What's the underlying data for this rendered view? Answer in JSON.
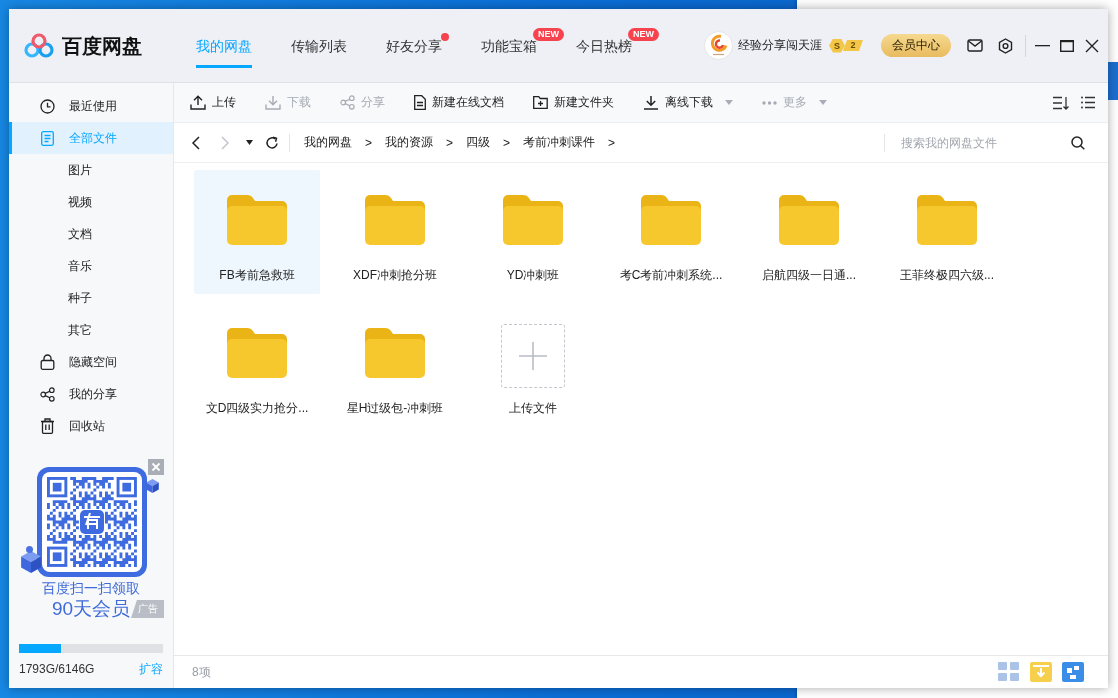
{
  "window": {
    "app_name": "百度网盘",
    "tabs": [
      {
        "label": "我的网盘",
        "selected": true,
        "dot": false
      },
      {
        "label": "传输列表",
        "selected": false,
        "dot": false
      },
      {
        "label": "好友分享",
        "selected": false,
        "dot": true
      },
      {
        "label": "功能宝箱",
        "selected": false,
        "dot": false,
        "badge": "NEW"
      },
      {
        "label": "今日热榜",
        "selected": false,
        "dot": false,
        "badge": "NEW"
      }
    ]
  },
  "user": {
    "name": "经验分享闯天涯",
    "level_badge": {
      "letter": "S",
      "level": "2"
    },
    "vip_button": "会员中心"
  },
  "toolbar": {
    "items": [
      {
        "kind": "upload",
        "label": "上传",
        "disabled": false,
        "dropdown": false
      },
      {
        "kind": "download",
        "label": "下载",
        "disabled": true,
        "dropdown": false
      },
      {
        "kind": "share",
        "label": "分享",
        "disabled": true,
        "dropdown": false
      },
      {
        "kind": "document",
        "label": "新建在线文档",
        "disabled": false,
        "dropdown": false
      },
      {
        "kind": "folder",
        "label": "新建文件夹",
        "disabled": false,
        "dropdown": false
      },
      {
        "kind": "offline",
        "label": "离线下载",
        "disabled": false,
        "dropdown": true
      },
      {
        "kind": "more",
        "label": "更多",
        "disabled": true,
        "dropdown": true
      }
    ]
  },
  "navigation": {
    "back_disabled": false,
    "forward_disabled": true,
    "breadcrumb": [
      "我的网盘",
      "我的资源",
      "四级",
      "考前冲刺课件"
    ],
    "separator": ">",
    "search": {
      "placeholder": "搜索我的网盘文件"
    }
  },
  "sidebar": {
    "items": [
      {
        "kind": "recent",
        "label": "最近使用",
        "selected": false
      },
      {
        "kind": "files",
        "label": "全部文件",
        "selected": true,
        "children": [
          {
            "label": "图片",
            "selected": false
          },
          {
            "label": "视频",
            "selected": false
          },
          {
            "label": "文档",
            "selected": false
          },
          {
            "label": "音乐",
            "selected": false
          },
          {
            "label": "种子",
            "selected": false
          },
          {
            "label": "其它",
            "selected": false
          }
        ]
      },
      {
        "kind": "hidden",
        "label": "隐藏空间",
        "selected": false
      },
      {
        "kind": "share",
        "label": "我的分享",
        "selected": false
      },
      {
        "kind": "trash",
        "label": "回收站",
        "selected": false
      }
    ],
    "ad": {
      "line1": "百度扫一扫领取",
      "line2": "90天会员",
      "tag": "广告"
    },
    "storage": {
      "level": 0.29,
      "usage": "1793G/6146G",
      "expand_link": "扩容"
    }
  },
  "files": {
    "items": [
      {
        "name": "FB考前急救班",
        "selected": true
      },
      {
        "name": "XDF冲刺抢分班",
        "selected": false
      },
      {
        "name": "YD冲刺班",
        "selected": false
      },
      {
        "name": "考C考前冲刺系统...",
        "selected": false
      },
      {
        "name": "启航四级一日通...",
        "selected": false
      },
      {
        "name": "王菲终极四六级...",
        "selected": false
      },
      {
        "name": "文D四级实力抢分...",
        "selected": false
      },
      {
        "name": "星H过级包-冲刺班",
        "selected": false
      }
    ],
    "upload_tile": {
      "label": "上传文件"
    }
  },
  "status_bar": {
    "count": "8项"
  }
}
